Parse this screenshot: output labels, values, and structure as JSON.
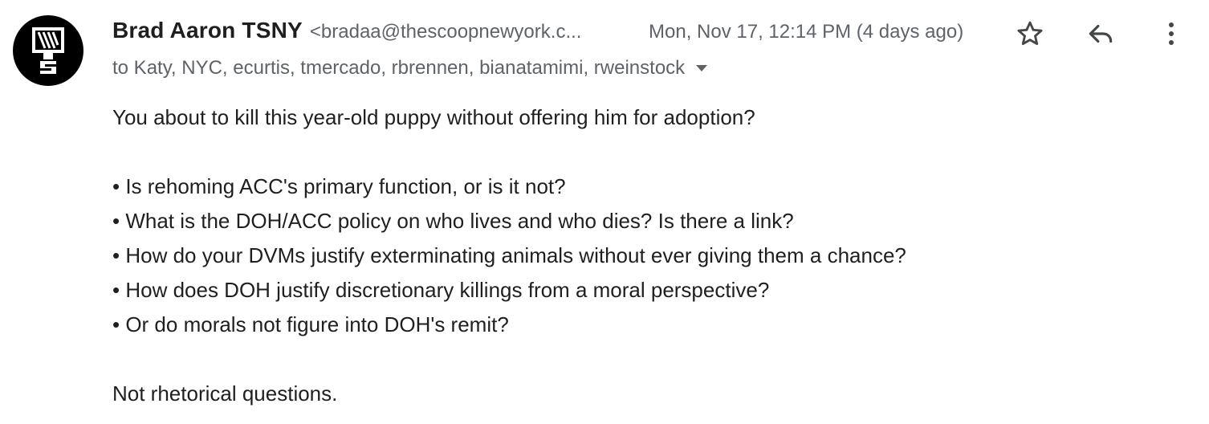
{
  "sender": {
    "name": "Brad Aaron TSNY",
    "email_display": "<bradaa@thescoopnewyork.c...",
    "avatar_icon": "tsny-logo-icon"
  },
  "timestamp": "Mon, Nov 17, 12:14 PM (4 days ago)",
  "recipients": "to Katy, NYC, ecurtis, tmercado, rbrennen, bianatamimi, rweinstock",
  "actions": {
    "star_icon": "star-icon",
    "reply_icon": "reply-icon",
    "more_icon": "more-vert-icon",
    "details_icon": "chevron-down-icon"
  },
  "message": {
    "opening": "You about to kill this year-old puppy without offering him for adoption?",
    "bullets": [
      "• Is rehoming ACC's primary function, or is it not?",
      "• What is the DOH/ACC policy on who lives and who dies? Is there a link?",
      "• How do your DVMs justify exterminating animals without ever giving them a chance?",
      "• How does DOH justify discretionary killings from a moral perspective?",
      "• Or do morals not figure into DOH's remit?"
    ],
    "closing": "Not rhetorical questions."
  },
  "colors": {
    "text_primary": "#1f1f1f",
    "text_secondary": "#5f6368",
    "avatar_bg": "#000000"
  }
}
